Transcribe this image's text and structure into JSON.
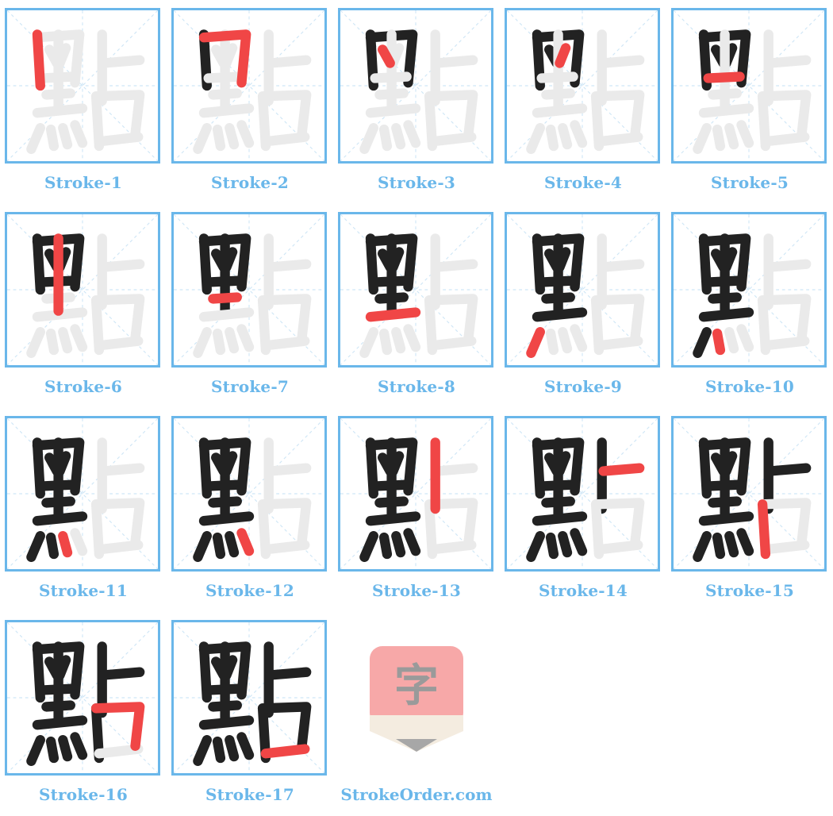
{
  "colors": {
    "border": "#6ab7ea",
    "label": "#6ab7ea",
    "guide": "#cfe6f6",
    "ghost": "#eaeaea",
    "done": "#222222",
    "current": "#f04646"
  },
  "strokes": [
    {
      "label": "Stroke-1"
    },
    {
      "label": "Stroke-2"
    },
    {
      "label": "Stroke-3"
    },
    {
      "label": "Stroke-4"
    },
    {
      "label": "Stroke-5"
    },
    {
      "label": "Stroke-6"
    },
    {
      "label": "Stroke-7"
    },
    {
      "label": "Stroke-8"
    },
    {
      "label": "Stroke-9"
    },
    {
      "label": "Stroke-10"
    },
    {
      "label": "Stroke-11"
    },
    {
      "label": "Stroke-12"
    },
    {
      "label": "Stroke-13"
    },
    {
      "label": "Stroke-14"
    },
    {
      "label": "Stroke-15"
    },
    {
      "label": "Stroke-16"
    },
    {
      "label": "Stroke-17"
    }
  ],
  "logo": {
    "glyph": "字",
    "site": "StrokeOrder.com",
    "icon": "pencil-character-icon"
  }
}
